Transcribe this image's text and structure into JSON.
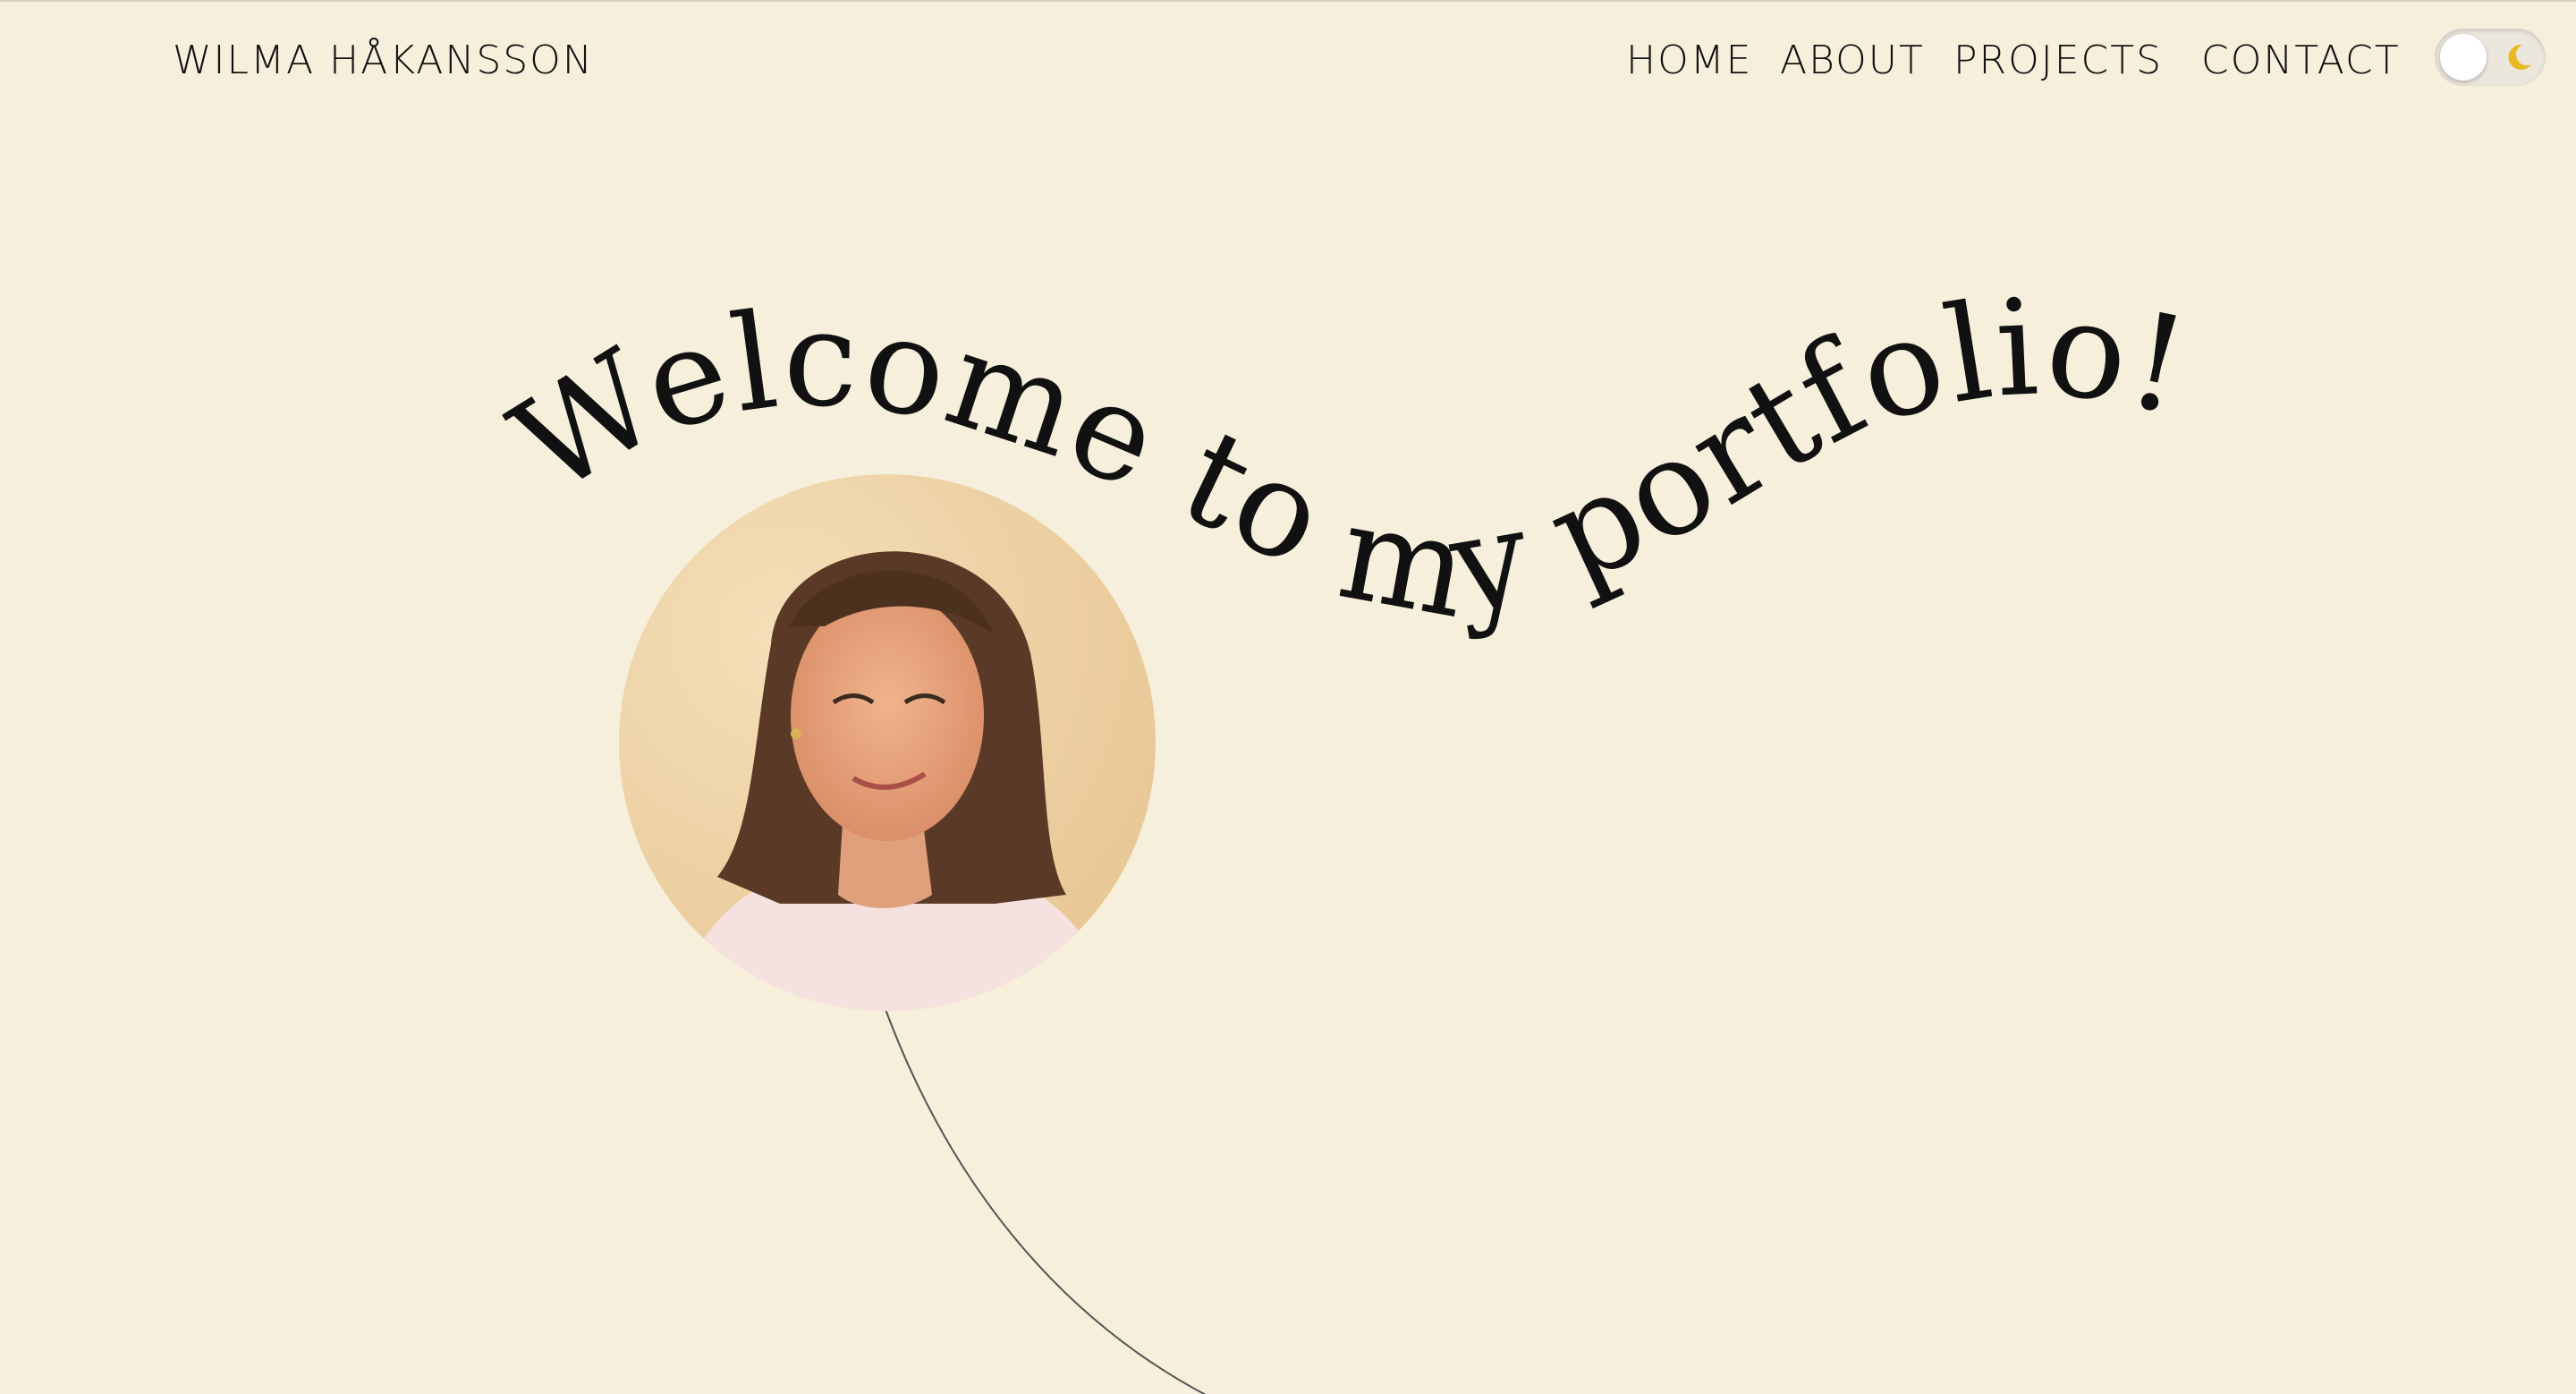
{
  "header": {
    "brand": "WILMA HÅKANSSON"
  },
  "nav": {
    "home": "HOME",
    "about": "ABOUT",
    "projects": "PROJECTS",
    "contact": "CONTACT"
  },
  "theme_toggle": {
    "state": "light",
    "icon": "moon-icon"
  },
  "hero": {
    "headline": "Welcome to my portfolio!",
    "portrait_icon": "portrait-photo"
  },
  "colors": {
    "background": "#f6efdc",
    "text": "#111111",
    "moon": "#e8b923"
  }
}
